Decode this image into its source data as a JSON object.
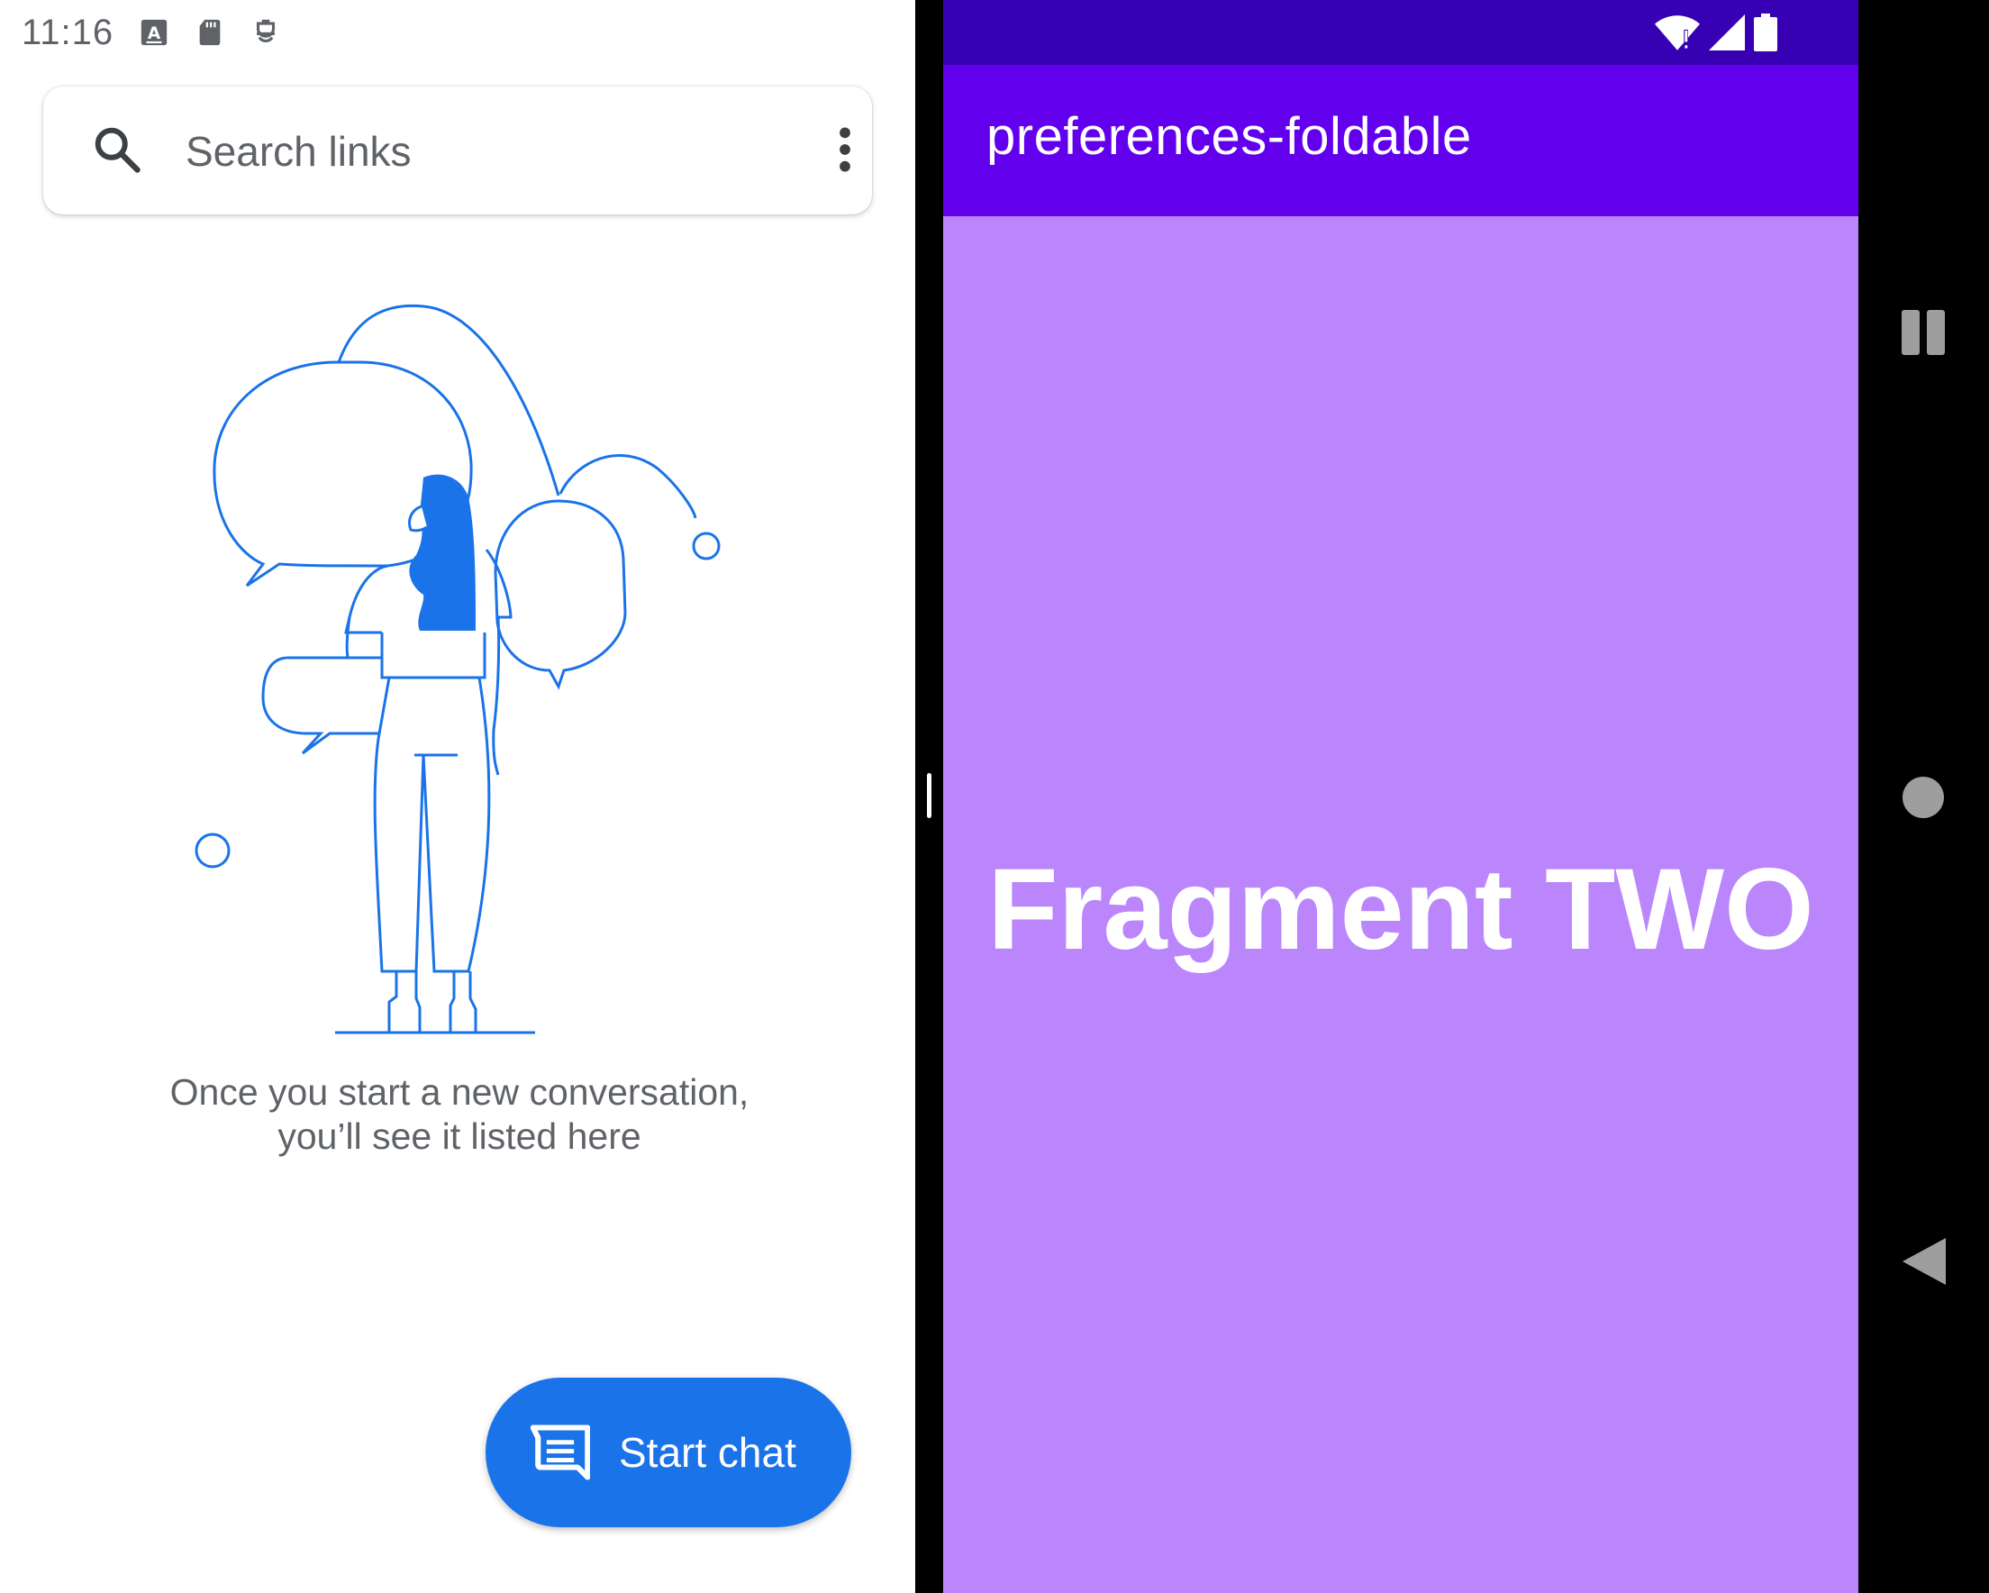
{
  "status_bar": {
    "time": "11:16",
    "notification_icons": [
      "font-icon",
      "sd-card-icon",
      "accessibility-icon"
    ],
    "system_icons": [
      "wifi-icon",
      "signal-icon",
      "battery-icon"
    ]
  },
  "messages": {
    "search": {
      "placeholder": "Search links"
    },
    "empty_state": {
      "message": "Once you start a new conversation, you’ll see it listed here"
    },
    "fab": {
      "label": "Start chat",
      "icon": "chat-icon"
    },
    "colors": {
      "accent": "#1a73e8",
      "text_secondary": "#5f6368"
    }
  },
  "preferences_app": {
    "title": "preferences-foldable",
    "fragment_label": "Fragment TWO",
    "colors": {
      "status_bar": "#3700b3",
      "app_bar": "#6200ee",
      "background": "#bb86fc"
    }
  },
  "nav_bar": {
    "buttons": [
      "recents-icon",
      "home-icon",
      "back-icon"
    ]
  }
}
